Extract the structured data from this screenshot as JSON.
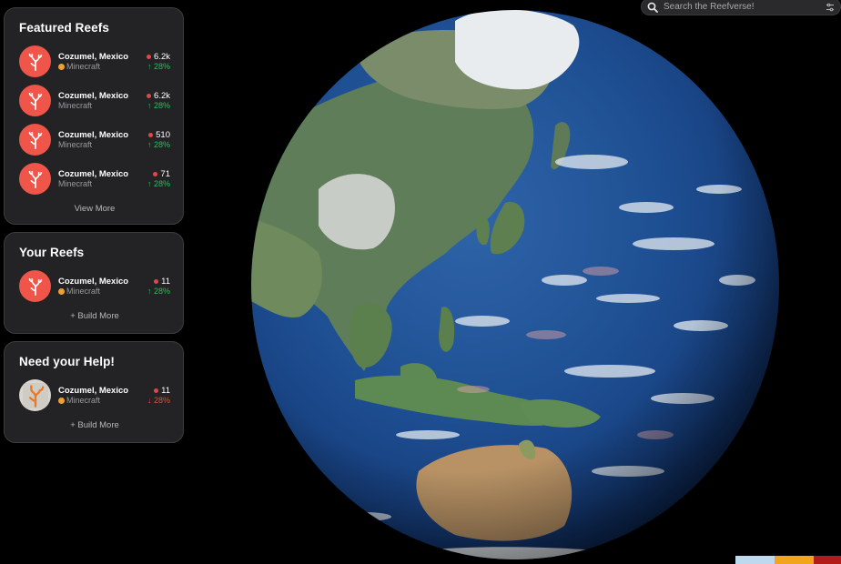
{
  "search": {
    "placeholder": "Search the Reefverse!"
  },
  "featured": {
    "title": "Featured Reefs",
    "items": [
      {
        "name": "Cozumel, Mexico",
        "platform": "Minecraft",
        "platform_badge": true,
        "count": "6.2k",
        "trend": "↑ 28%",
        "trend_dir": "up"
      },
      {
        "name": "Cozumel, Mexico",
        "platform": "Minecraft",
        "platform_badge": false,
        "count": "6.2k",
        "trend": "↑ 28%",
        "trend_dir": "up"
      },
      {
        "name": "Cozumel, Mexico",
        "platform": "Minecraft",
        "platform_badge": false,
        "count": "510",
        "trend": "↑ 28%",
        "trend_dir": "up"
      },
      {
        "name": "Cozumel, Mexico",
        "platform": "Minecraft",
        "platform_badge": false,
        "count": "71",
        "trend": "↑ 28%",
        "trend_dir": "up"
      }
    ],
    "more_label": "View More"
  },
  "yours": {
    "title": "Your Reefs",
    "items": [
      {
        "name": "Cozumel, Mexico",
        "platform": "Minecraft",
        "platform_badge": true,
        "count": "11",
        "trend": "↑ 28%",
        "trend_dir": "up"
      }
    ],
    "more_label": "+ Build More"
  },
  "help": {
    "title": "Need your Help!",
    "items": [
      {
        "name": "Cozumel, Mexico",
        "platform": "Minecraft",
        "platform_badge": true,
        "count": "11",
        "trend": "↓ 28%",
        "trend_dir": "down"
      }
    ],
    "more_label": "+ Build More"
  },
  "icons": {
    "search": "search-icon",
    "filter": "filter-icon",
    "reef": "coral-icon"
  },
  "colors": {
    "accent": "#f0554a",
    "up": "#2dbb5f",
    "down": "#d8533b",
    "strip": [
      "#bcd9ee",
      "#f2a51c",
      "#b01c1c"
    ]
  }
}
